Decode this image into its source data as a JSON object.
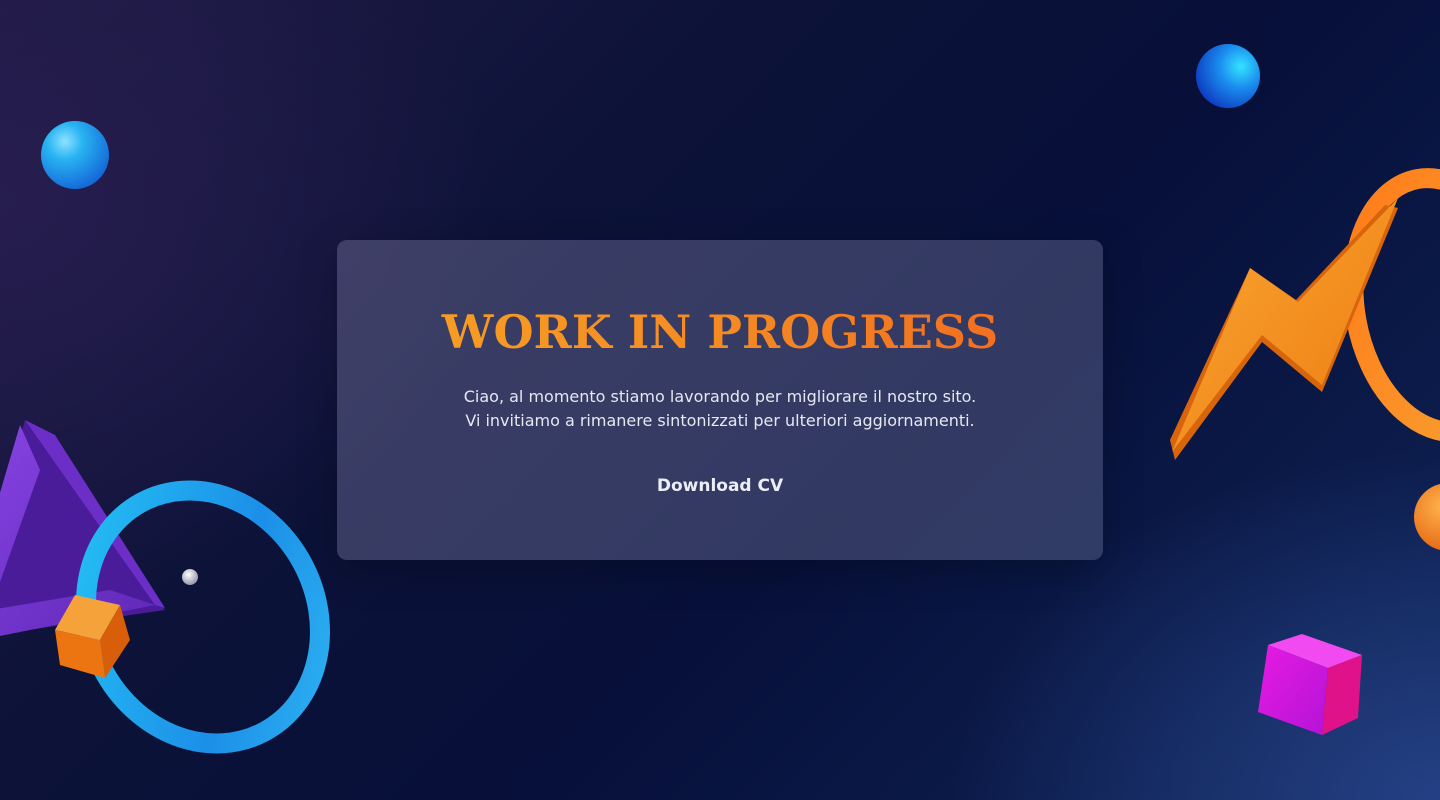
{
  "hero": {
    "title": "WORK IN PROGRESS",
    "description_line1": "Ciao, al momento stiamo lavorando per migliorare il nostro sito.",
    "description_line2": "Vi invitiamo a rimanere sintonizzati per ulteriori aggiornamenti.",
    "button_label": "Download CV"
  },
  "colors": {
    "background_dark": "#07103a",
    "title_gradient_start": "#f7a325",
    "title_gradient_end": "#f06622",
    "card_bg": "rgba(88,88,128,0.6)",
    "accent_blue": "#1fa8ef",
    "accent_purple": "#7a3bd6",
    "accent_orange": "#f58a23",
    "accent_pink": "#e21bd9"
  },
  "decorations": [
    "blue-sphere",
    "purple-triangle",
    "blue-ring",
    "orange-cube",
    "silver-bead",
    "orange-lightning",
    "orange-ring",
    "orange-sphere",
    "pink-cube"
  ]
}
